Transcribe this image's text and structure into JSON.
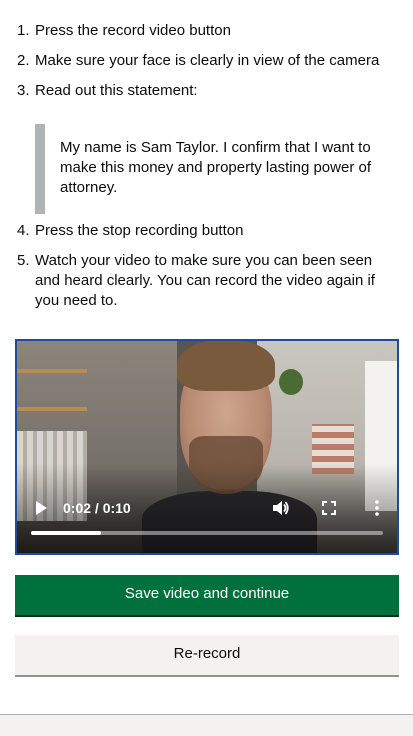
{
  "instructions": [
    {
      "num": "1.",
      "text": "Press the record video button"
    },
    {
      "num": "2.",
      "text": "Make sure your face is clearly in view of the camera"
    },
    {
      "num": "3.",
      "text": "Read out this statement:"
    },
    {
      "num": "4.",
      "text": "Press the stop recording button"
    },
    {
      "num": "5.",
      "text": "Watch your video to make sure you can been seen and heard clearly. You can record the video again if you need to."
    }
  ],
  "statement": "My name is Sam Taylor. I confirm that I want to make this money and property lasting power of attorney.",
  "video": {
    "time_display": "0:02 / 0:10",
    "progress_fraction": 0.2,
    "controls": [
      "play-icon",
      "volume-icon",
      "fullscreen-icon",
      "more-options-icon"
    ]
  },
  "buttons": {
    "primary_label": "Save video and continue",
    "secondary_label": "Re-record"
  },
  "colors": {
    "primary": "#00703c",
    "focus_border": "#1d4ba0",
    "inset_border": "#b1b4b6"
  }
}
